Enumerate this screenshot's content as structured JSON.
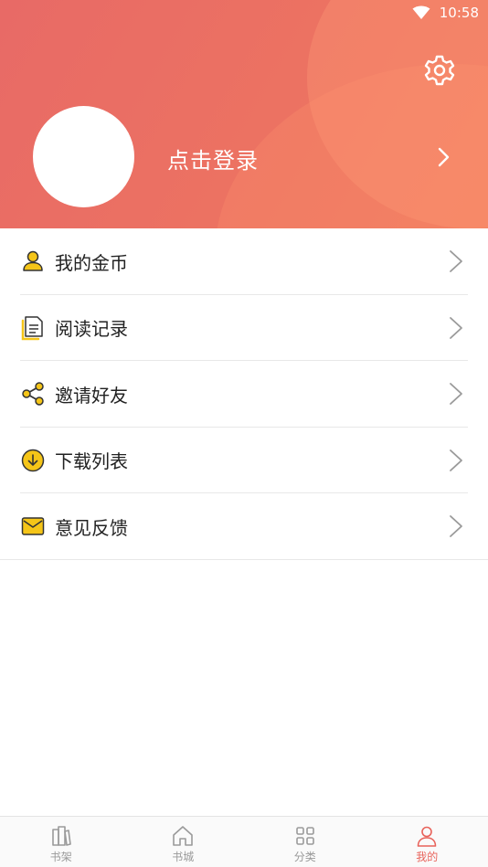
{
  "status_bar": {
    "time": "10:58",
    "wifi_icon": "wifi-icon"
  },
  "header": {
    "login_text": "点击登录",
    "settings_icon": "gear-icon",
    "colors": {
      "bg_start": "#e86a66",
      "bg_end": "#f07a5e"
    }
  },
  "menu": {
    "items": [
      {
        "label": "我的金币",
        "icon": "person-icon"
      },
      {
        "label": "阅读记录",
        "icon": "document-icon"
      },
      {
        "label": "邀请好友",
        "icon": "share-icon"
      },
      {
        "label": "下载列表",
        "icon": "download-icon"
      },
      {
        "label": "意见反馈",
        "icon": "mail-icon"
      }
    ],
    "icon_color": "#f5c518"
  },
  "tabbar": {
    "tabs": [
      {
        "label": "书架",
        "icon": "bookshelf-icon",
        "active": false
      },
      {
        "label": "书城",
        "icon": "home-icon",
        "active": false
      },
      {
        "label": "分类",
        "icon": "grid-icon",
        "active": false
      },
      {
        "label": "我的",
        "icon": "user-icon",
        "active": true
      }
    ],
    "active_color": "#e8635b"
  }
}
